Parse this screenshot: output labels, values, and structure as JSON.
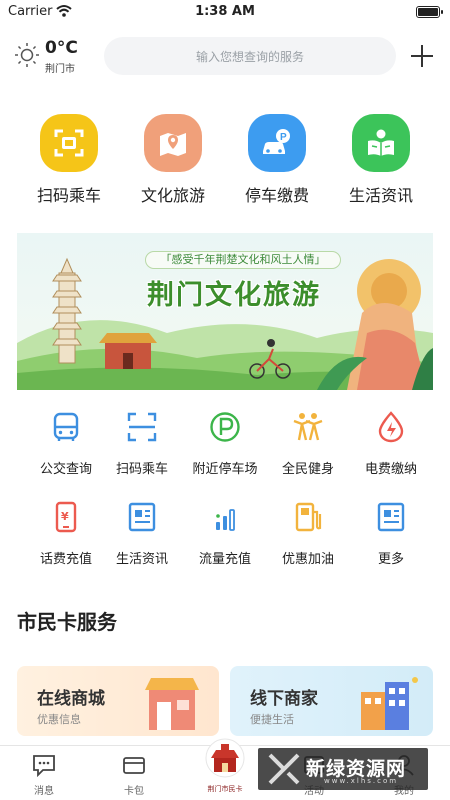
{
  "status_bar": {
    "carrier": "Carrier",
    "time": "1:38 AM"
  },
  "header": {
    "temperature": "0°C",
    "city": "荆门市",
    "search_placeholder": "输入您想查询的服务",
    "weather_icon": "sun-icon",
    "add_icon": "plus-icon"
  },
  "main_services": [
    {
      "label": "扫码乘车",
      "icon": "scan-icon",
      "color": "#f5c518"
    },
    {
      "label": "文化旅游",
      "icon": "map-icon",
      "color": "#f0a07a"
    },
    {
      "label": "停车缴费",
      "icon": "parking-car-icon",
      "color": "#3d9cf0"
    },
    {
      "label": "生活资讯",
      "icon": "reading-person-icon",
      "color": "#3cc45a"
    }
  ],
  "banner": {
    "subtitle": "「感受千年荆楚文化和风土人情」",
    "title": "荆门文化旅游"
  },
  "grid_services": [
    {
      "label": "公交查询",
      "icon": "bus-icon"
    },
    {
      "label": "扫码乘车",
      "icon": "scan-icon"
    },
    {
      "label": "附近停车场",
      "icon": "parking-icon"
    },
    {
      "label": "全民健身",
      "icon": "fitness-icon"
    },
    {
      "label": "电费缴纳",
      "icon": "electricity-icon"
    },
    {
      "label": "话费充值",
      "icon": "phone-bill-icon"
    },
    {
      "label": "生活资讯",
      "icon": "news-icon"
    },
    {
      "label": "流量充值",
      "icon": "data-bars-icon"
    },
    {
      "label": "优惠加油",
      "icon": "fuel-icon"
    },
    {
      "label": "更多",
      "icon": "more-icon"
    }
  ],
  "section": {
    "title": "市民卡服务"
  },
  "cards": [
    {
      "title": "在线商城",
      "subtitle": "优惠信息",
      "icon": "shop-icon"
    },
    {
      "title": "线下商家",
      "subtitle": "便捷生活",
      "icon": "store-buildings-icon"
    }
  ],
  "tabs": [
    {
      "label": "消息",
      "icon": "message-icon"
    },
    {
      "label": "卡包",
      "icon": "wallet-icon"
    },
    {
      "label": "荆门市民卡",
      "icon": "citizen-card-logo-icon"
    },
    {
      "label": "活动",
      "icon": "activity-icon"
    },
    {
      "label": "我的",
      "icon": "profile-icon"
    }
  ],
  "watermark": {
    "text": "新绿资源网",
    "url": "www.xlhs.com"
  }
}
